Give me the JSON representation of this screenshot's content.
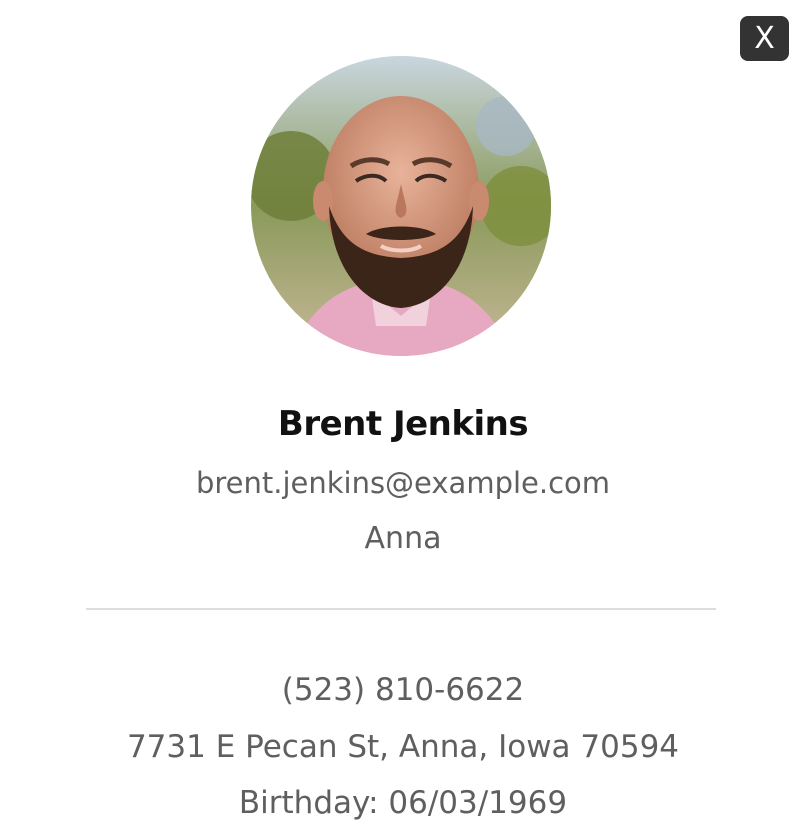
{
  "close_button": {
    "label": "X"
  },
  "profile": {
    "name": "Brent Jenkins",
    "email": "brent.jenkins@example.com",
    "city": "Anna"
  },
  "details": {
    "phone": "(523) 810-6622",
    "address": "7731 E Pecan St, Anna, Iowa 70594",
    "birthday": "Birthday: 06/03/1969"
  },
  "colors": {
    "close_button_bg": "#333333",
    "name_text": "#111111",
    "secondary_text": "#5f5f5f",
    "divider": "#dddddd"
  }
}
